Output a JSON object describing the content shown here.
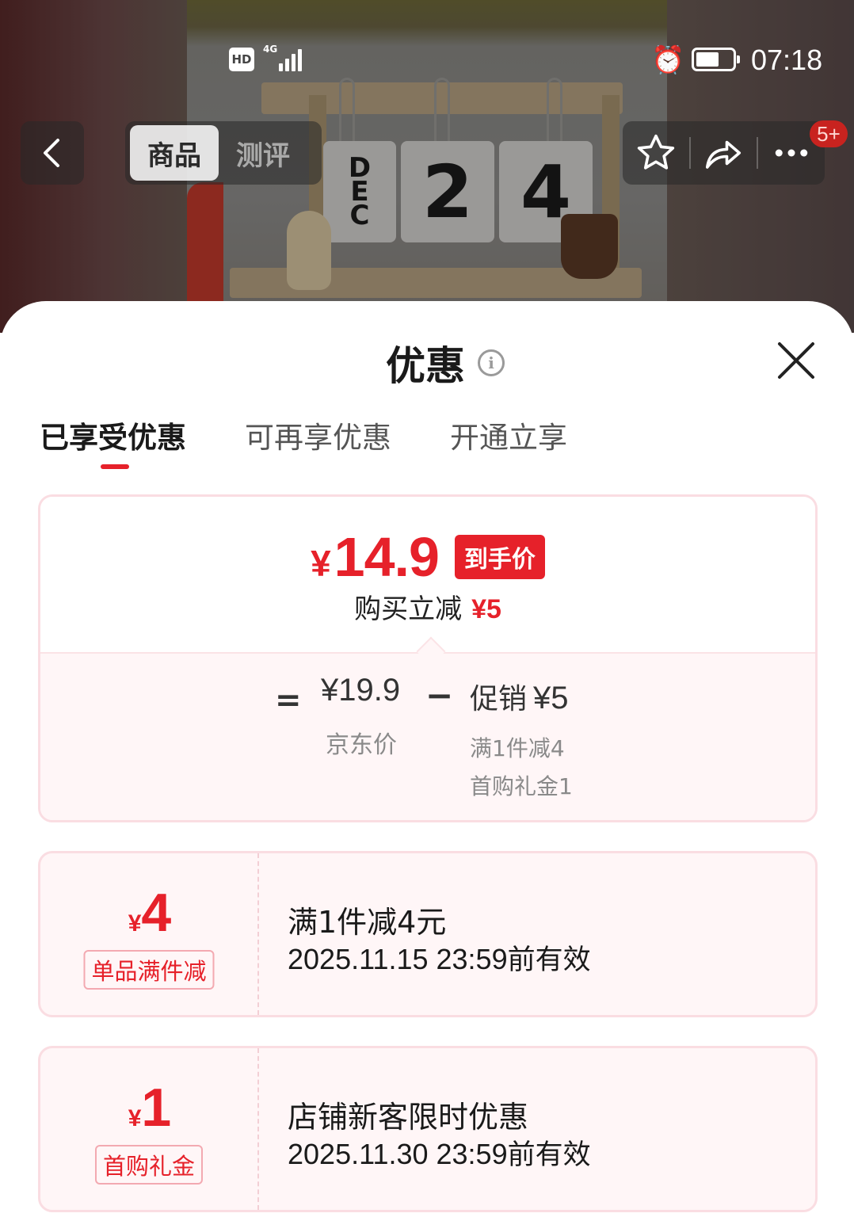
{
  "status_bar": {
    "hd": "HD",
    "network": "4G",
    "signal_level": 4,
    "battery_level": 0.55,
    "time": "07:18"
  },
  "photo": {
    "month_letters": [
      "D",
      "E",
      "C"
    ],
    "day_digits": [
      "2",
      "4"
    ]
  },
  "nav": {
    "tabs": [
      {
        "label": "商品",
        "active": true
      },
      {
        "label": "测评",
        "active": false
      }
    ],
    "badge": "5+"
  },
  "sheet": {
    "title": "优惠",
    "tabs": [
      {
        "label": "已享受优惠",
        "active": true
      },
      {
        "label": "可再享优惠",
        "active": false
      },
      {
        "label": "开通立享",
        "active": false
      }
    ]
  },
  "summary": {
    "currency": "¥",
    "final_price": "14.9",
    "final_tag": "到手价",
    "save_label": "购买立减",
    "save_amount": "¥5",
    "equals": "=",
    "jd_price": "¥19.9",
    "jd_label": "京东价",
    "minus": "−",
    "promo_label": "促销",
    "promo_amount": "¥5",
    "promo_details": [
      "满1件减4",
      "首购礼金1"
    ]
  },
  "coupons": [
    {
      "currency": "¥",
      "amount": "4",
      "type": "单品满件减",
      "title": "满1件减4元",
      "valid_date": "2025.11.15 23:59",
      "valid_suffix": "前有效"
    },
    {
      "currency": "¥",
      "amount": "1",
      "type": "首购礼金",
      "title": "店铺新客限时优惠",
      "valid_date": "2025.11.30 23:59",
      "valid_suffix": "前有效"
    }
  ],
  "colors": {
    "accent": "#e6212a",
    "card_border": "#fadde2",
    "card_bg": "#fff6f7"
  }
}
